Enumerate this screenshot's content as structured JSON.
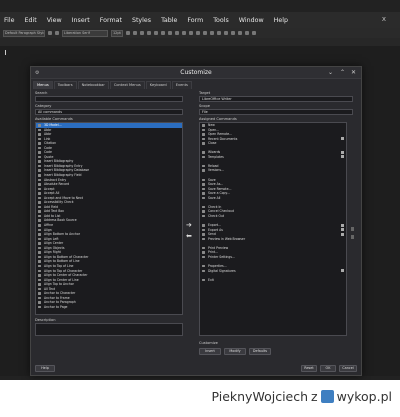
{
  "menubar": {
    "items": [
      "File",
      "Edit",
      "View",
      "Insert",
      "Format",
      "Styles",
      "Table",
      "Form",
      "Tools",
      "Window",
      "Help"
    ],
    "close_glyph": "x"
  },
  "toolbar": {
    "style_value": "Default Paragraph Style",
    "font_value": "Liberation Serif",
    "size_value": "12pt"
  },
  "dialog": {
    "title": "Customize",
    "tabs": [
      "Menus",
      "Toolbars",
      "Notebookbar",
      "Context Menus",
      "Keyboard",
      "Events"
    ],
    "active_tab": 0,
    "search_label": "Search",
    "category_label": "Category",
    "category_value": "All commands",
    "available_label": "Available Commands",
    "target_label": "Target",
    "target_value": "LibreOffice Writer",
    "scope_label": "Scope",
    "scope_value": "File",
    "assigned_label": "Assigned Commands",
    "description_label": "Description",
    "customize_label": "Customize",
    "buttons": {
      "help": "Help",
      "reset": "Reset",
      "ok": "OK",
      "cancel": "Cancel",
      "insert": "Insert",
      "modify": "Modify",
      "defaults": "Defaults"
    },
    "available_commands": [
      "3D Model...",
      "Abbr",
      "Abbr",
      "Link",
      "Citation",
      "Code",
      "Code",
      "Quote",
      "Insert Bibliography",
      "Insert Bibliography Entry",
      "Insert Bibliography Database",
      "Insert Bibliography Field",
      "Abstract Entry",
      "Absolute Record",
      "Accept",
      "Accept All",
      "Accept and Move to Next",
      "Accessibility Check",
      "Add Field",
      "Add Text Box",
      "Add to List",
      "Address Book Source",
      "Affine",
      "Align",
      "Align Bottom to Anchor",
      "Align Left",
      "Align Center",
      "Align Objects",
      "Align Right",
      "Align to Bottom of Character",
      "Align to Bottom of Line",
      "Align to Top of Line",
      "Align to Top of Character",
      "Align to Center of Character",
      "Align to Center of Line",
      "Align Top to Anchor",
      "All Text",
      "Anchor to Character",
      "Anchor to Frame",
      "Anchor to Paragraph",
      "Anchor to Page"
    ],
    "assigned_commands": [
      "New",
      "Open...",
      "Open Remote...",
      "Recent Documents",
      "Close",
      "",
      "Wizards",
      "Templates",
      "",
      "Reload",
      "Versions...",
      "",
      "Save",
      "Save As...",
      "Save Remote...",
      "Save a Copy...",
      "Save All",
      "",
      "Check In",
      "Cancel Checkout",
      "Check Out",
      "",
      "Export...",
      "Export As",
      "Send",
      "Preview in Web Browser",
      "",
      "Print Preview",
      "Print...",
      "Printer Settings...",
      "",
      "Properties...",
      "Digital Signatures",
      "",
      "Exit"
    ]
  },
  "watermark": {
    "user": "PieknyWojciech",
    "z": "z",
    "site": "wykop.pl"
  }
}
